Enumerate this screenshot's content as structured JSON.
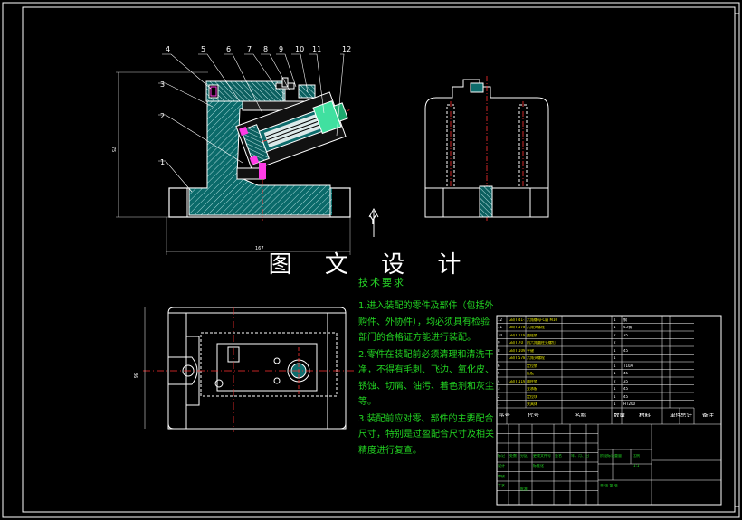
{
  "watermark": "图 文 设 计",
  "tech_req_title": "技术要求",
  "tech_notes": [
    "1.进入装配的零件及部件（包括外购件、外协件），均必须具有检验部门的合格证方能进行装配。",
    "2.零件在装配前必须清理和清洗干净，不得有毛刺、飞边、氧化皮、锈蚀、切屑、油污、着色剂和灰尘等。",
    "3.装配前应对零、部件的主要配合尺寸，特别是过盈配合尺寸及相关精度进行复查。"
  ],
  "balloon_labels": [
    "1",
    "2",
    "3",
    "4",
    "5",
    "6",
    "7",
    "8",
    "9",
    "10",
    "11",
    "12"
  ],
  "view_label": "Y",
  "dimensions": {
    "height": "75",
    "width": "167",
    "plan": "86"
  },
  "bom": {
    "rows": [
      [
        "12",
        "GB/T 41-2000",
        "六角螺母-C级 M10",
        "1",
        "钢",
        "",
        ""
      ],
      [
        "11",
        "GB/T 5782",
        "六角头螺栓",
        "1",
        "45钢",
        "",
        ""
      ],
      [
        "10",
        "GB/T 119",
        "圆柱销",
        "2",
        "35",
        "",
        ""
      ],
      [
        "9",
        "GB/T 70",
        "内六角圆柱头螺钉",
        "2",
        "",
        "",
        ""
      ],
      [
        "8",
        "GB/T 1096",
        "平键",
        "1",
        "45",
        "",
        ""
      ],
      [
        "7",
        "GB/T 5783",
        "六角头螺栓",
        "1",
        "",
        "",
        ""
      ],
      [
        "6",
        "",
        "定位销",
        "1",
        "T10A",
        "",
        ""
      ],
      [
        "5",
        "",
        "压板",
        "1",
        "45",
        "",
        ""
      ],
      [
        "4",
        "GB/T 119",
        "圆柱销",
        "2",
        "35",
        "",
        ""
      ],
      [
        "3",
        "",
        "支承板",
        "1",
        "45",
        "",
        ""
      ],
      [
        "2",
        "",
        "定位块",
        "1",
        "45",
        "",
        ""
      ],
      [
        "1",
        "",
        "夹具体",
        "1",
        "HT200",
        "",
        ""
      ]
    ],
    "header": [
      "序号",
      "代号",
      "名称",
      "数量",
      "材料",
      "单件",
      "总计",
      "备注"
    ],
    "title_labels": [
      "标记",
      "处数",
      "分区",
      "更改文件号",
      "签名",
      "年、月、日",
      "设计",
      "标准化",
      "阶段标记",
      "重量",
      "比例",
      "审核",
      "工艺",
      "批准",
      "共 张 第 张"
    ],
    "scale": "1:1"
  },
  "colors": {
    "outline": "#ffffff",
    "section": "#00c8c8",
    "hatch": "#c8c8c8",
    "fastener": "#ff3ce6",
    "centerline": "#ff3030",
    "notes": "#22d422",
    "bolt_fill": "#40e0a0"
  }
}
